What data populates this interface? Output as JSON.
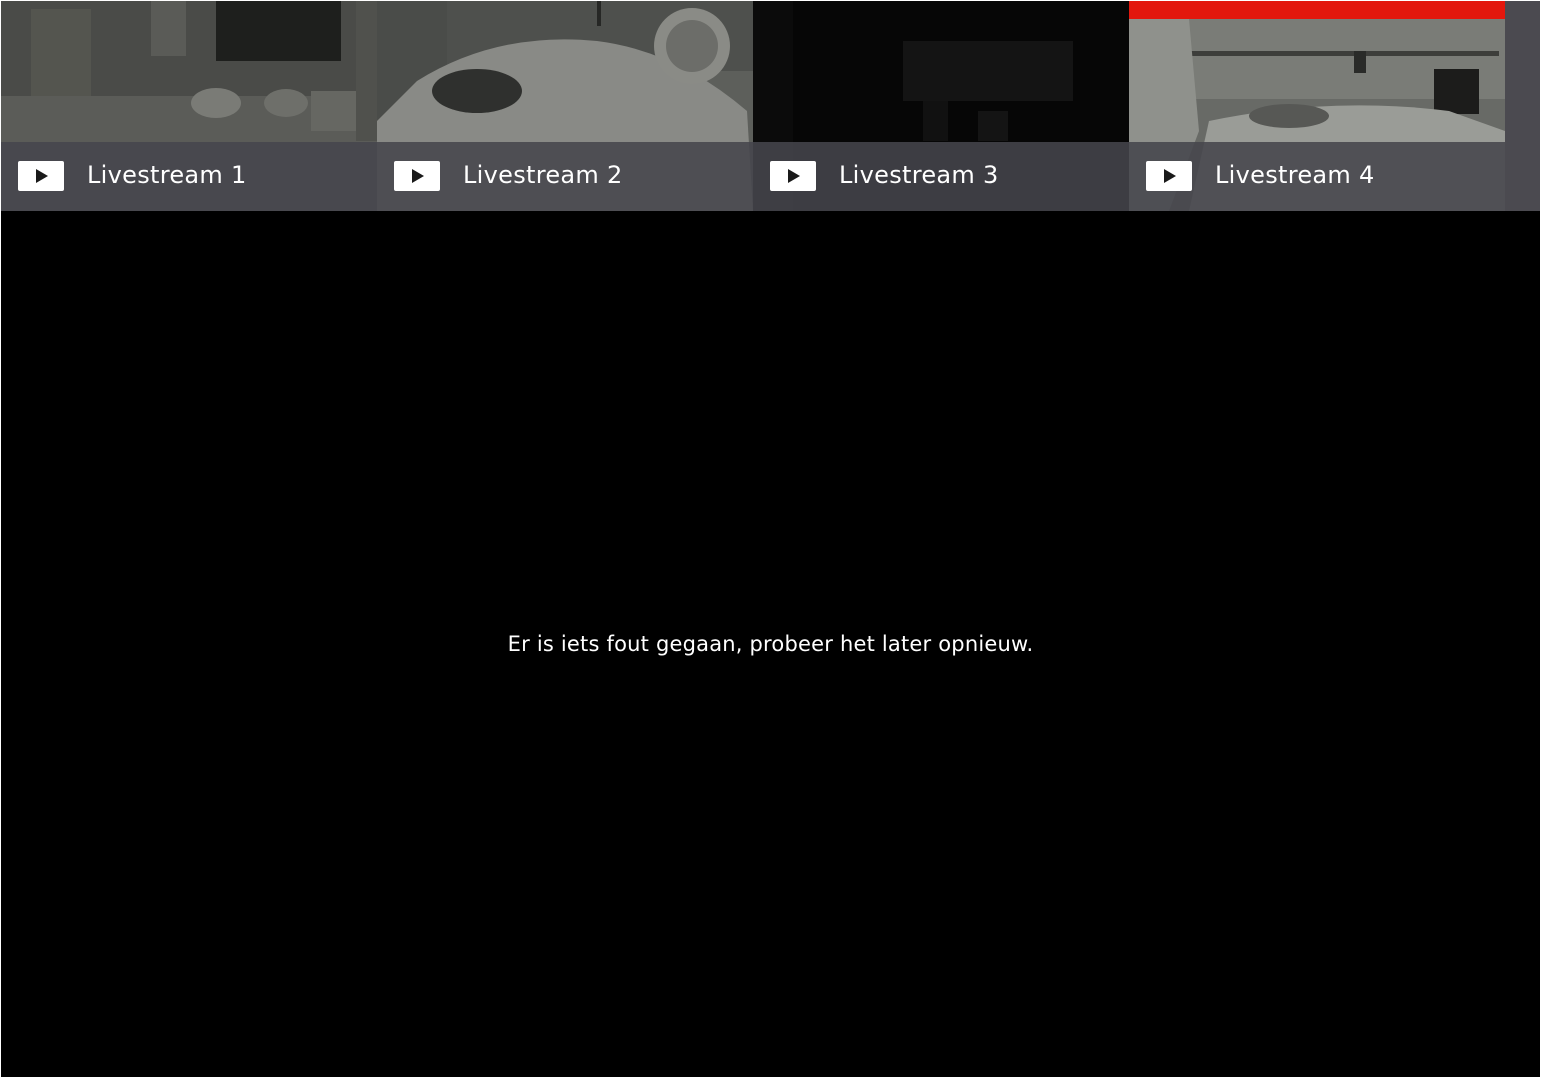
{
  "streams": [
    {
      "label": "Livestream 1",
      "active": false
    },
    {
      "label": "Livestream 2",
      "active": false
    },
    {
      "label": "Livestream 3",
      "active": false
    },
    {
      "label": "Livestream 4",
      "active": true
    }
  ],
  "icons": {
    "play": "play-icon"
  },
  "colors": {
    "active_indicator": "#e3170d",
    "tile_bar": "#46464c",
    "background": "#000000",
    "text": "#ffffff"
  },
  "player": {
    "error_message": "Er is iets fout gegaan, probeer het later opnieuw."
  }
}
